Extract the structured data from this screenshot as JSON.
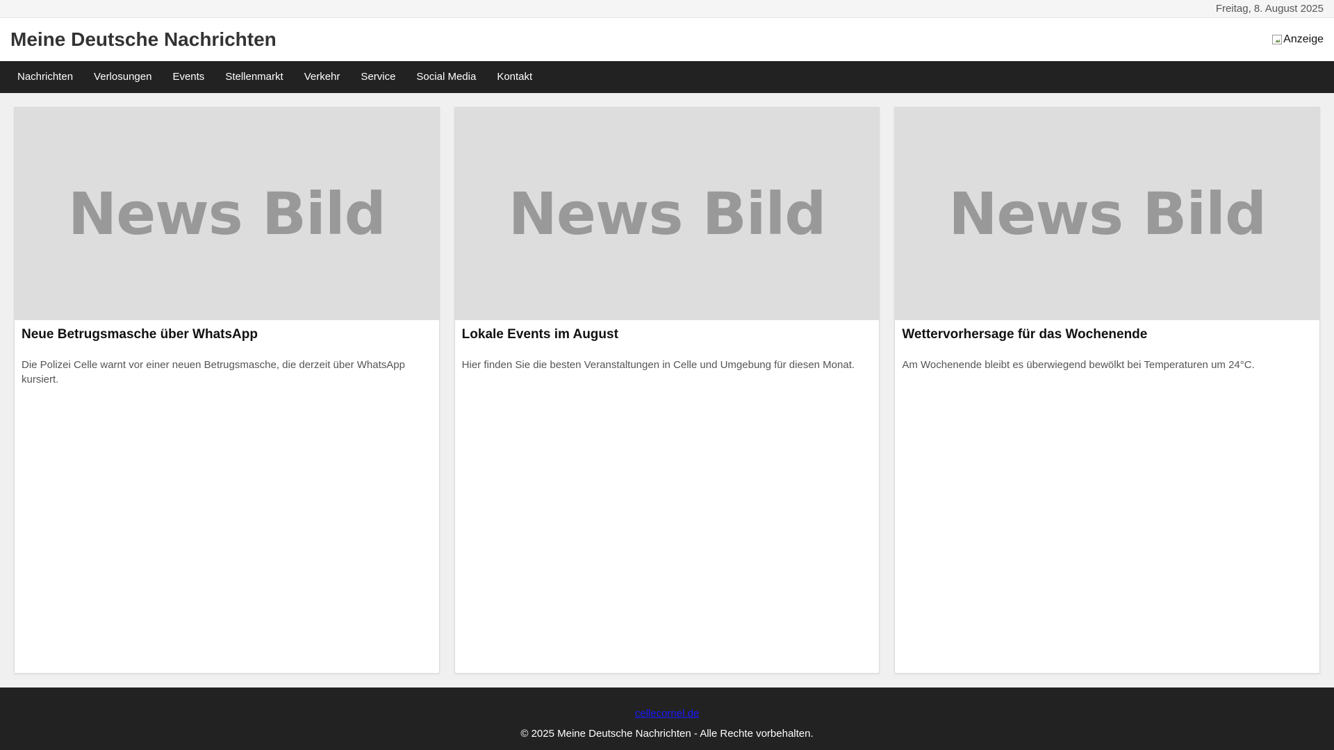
{
  "topbar": {
    "date": "Freitag, 8. August 2025"
  },
  "header": {
    "title": "Meine Deutsche Nachrichten",
    "ad_alt": "Anzeige"
  },
  "nav": {
    "items": [
      {
        "label": "Nachrichten"
      },
      {
        "label": "Verlosungen"
      },
      {
        "label": "Events"
      },
      {
        "label": "Stellenmarkt"
      },
      {
        "label": "Verkehr"
      },
      {
        "label": "Service"
      },
      {
        "label": "Social Media"
      },
      {
        "label": "Kontakt"
      }
    ]
  },
  "articles": [
    {
      "image_text": "News Bild",
      "title": "Neue Betrugsmasche über WhatsApp",
      "text": "Die Polizei Celle warnt vor einer neuen Betrugsmasche, die derzeit über WhatsApp kursiert."
    },
    {
      "image_text": "News Bild",
      "title": "Lokale Events im August",
      "text": "Hier finden Sie die besten Veranstaltungen in Celle und Umgebung für diesen Monat."
    },
    {
      "image_text": "News Bild",
      "title": "Wettervorhersage für das Wochenende",
      "text": "Am Wochenende bleibt es überwiegend bewölkt bei Temperaturen um 24°C."
    }
  ],
  "footer": {
    "link": "cellecornel.de",
    "copyright": "© 2025 Meine Deutsche Nachrichten - Alle Rechte vorbehalten."
  },
  "colors": {
    "nav_bg": "#222222",
    "footer_bg": "#222222",
    "image_placeholder": "#dddddd"
  }
}
